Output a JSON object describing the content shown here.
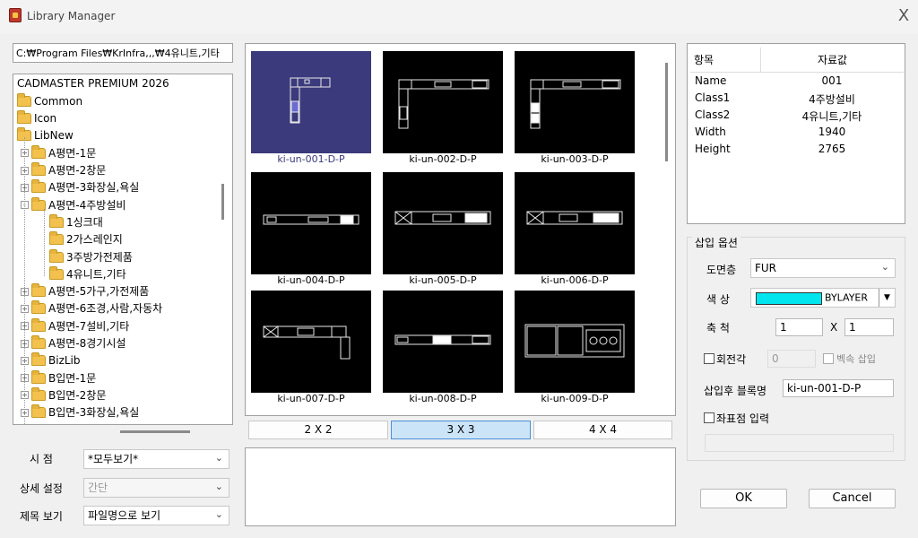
{
  "window": {
    "title": "Library Manager",
    "close": "X"
  },
  "path": "C:₩Program Files₩KrInfra,,,₩4유니트,기타",
  "tree": {
    "root": "CADMASTER PREMIUM 2026",
    "items": [
      {
        "label": "Common",
        "level": 0,
        "expander": ""
      },
      {
        "label": "Icon",
        "level": 0,
        "expander": ""
      },
      {
        "label": "LibNew",
        "level": 0,
        "expander": ""
      },
      {
        "label": "A평면-1문",
        "level": 1,
        "expander": "+"
      },
      {
        "label": "A평면-2창문",
        "level": 1,
        "expander": "+"
      },
      {
        "label": "A평면-3화장실,욕실",
        "level": 1,
        "expander": "+"
      },
      {
        "label": "A평면-4주방설비",
        "level": 1,
        "expander": "-"
      },
      {
        "label": "1싱크대",
        "level": 2,
        "expander": ""
      },
      {
        "label": "2가스레인지",
        "level": 2,
        "expander": ""
      },
      {
        "label": "3주방가전제품",
        "level": 2,
        "expander": ""
      },
      {
        "label": "4유니트,기타",
        "level": 2,
        "expander": ""
      },
      {
        "label": "A평면-5가구,가전제품",
        "level": 1,
        "expander": "+"
      },
      {
        "label": "A평면-6조경,사람,자동차",
        "level": 1,
        "expander": "+"
      },
      {
        "label": "A평면-7설비,기타",
        "level": 1,
        "expander": "+"
      },
      {
        "label": "A평면-8경기시설",
        "level": 1,
        "expander": "+"
      },
      {
        "label": "BizLib",
        "level": 1,
        "expander": "+"
      },
      {
        "label": "B입면-1문",
        "level": 1,
        "expander": "+"
      },
      {
        "label": "B입면-2창문",
        "level": 1,
        "expander": "+"
      },
      {
        "label": "B입면-3화장실,욕실",
        "level": 1,
        "expander": "+"
      }
    ]
  },
  "view": {
    "viewpoint_label": "시 점",
    "viewpoint_value": "*모두보기*",
    "detail_label": "상세 설정",
    "detail_value": "간단",
    "title_label": "제목 보기",
    "title_value": "파일명으로 보기"
  },
  "thumbnails": [
    "ki-un-001-D-P",
    "ki-un-002-D-P",
    "ki-un-003-D-P",
    "ki-un-004-D-P",
    "ki-un-005-D-P",
    "ki-un-006-D-P",
    "ki-un-007-D-P",
    "ki-un-008-D-P",
    "ki-un-009-D-P"
  ],
  "grid_buttons": [
    "2 X 2",
    "3 X 3",
    "4 X 4"
  ],
  "properties": {
    "header_key": "항목",
    "header_value": "자료값",
    "rows": [
      {
        "key": "Name",
        "value": "001"
      },
      {
        "key": "Class1",
        "value": "4주방설비"
      },
      {
        "key": "Class2",
        "value": "4유니트,기타"
      },
      {
        "key": "Width",
        "value": "1940"
      },
      {
        "key": "Height",
        "value": "2765"
      }
    ]
  },
  "insert": {
    "section_title": "삽입 옵션",
    "layer_label": "도면층",
    "layer_value": "FUR",
    "color_label": "색  상",
    "color_value": "BYLAYER",
    "color_swatch": "#00e5ee",
    "scale_label": "축  척",
    "scale_x": "1",
    "scale_sep": "X",
    "scale_y": "1",
    "rotate_label": "회전각",
    "rotate_value": "0",
    "multi_label": "벡속 삽입",
    "blockname_label": "삽입후 블록명",
    "blockname_value": "ki-un-001-D-P",
    "coord_label": "좌표점 입력"
  },
  "buttons": {
    "ok": "OK",
    "cancel": "Cancel"
  }
}
